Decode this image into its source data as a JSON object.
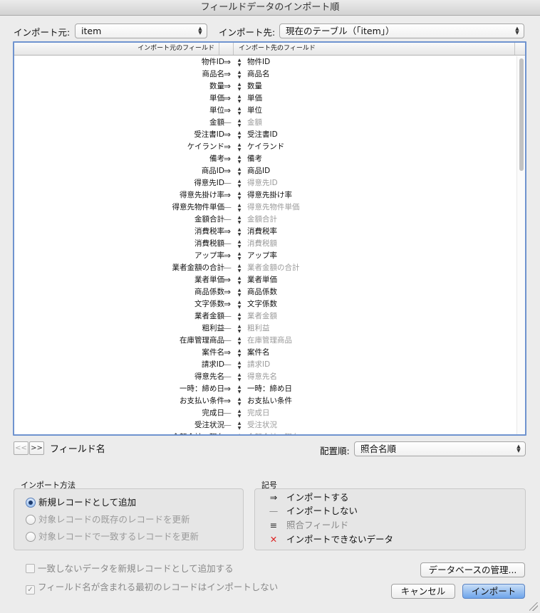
{
  "window": {
    "title": "フィールドデータのインポート順"
  },
  "source": {
    "label": "インポート元:",
    "value": "item"
  },
  "target": {
    "label": "インポート先:",
    "value": "現在のテーブル（「item」）"
  },
  "table": {
    "header_source": "インポート元のフィールド",
    "header_target": "インポート先のフィールド",
    "rows": [
      {
        "src": "物件ID",
        "import": true,
        "dst": "物件ID"
      },
      {
        "src": "商品名",
        "import": true,
        "dst": "商品名"
      },
      {
        "src": "数量",
        "import": true,
        "dst": "数量"
      },
      {
        "src": "単価",
        "import": true,
        "dst": "単価"
      },
      {
        "src": "単位",
        "import": true,
        "dst": "単位"
      },
      {
        "src": "金額",
        "import": false,
        "dst": "金額"
      },
      {
        "src": "受注書ID",
        "import": true,
        "dst": "受注書ID"
      },
      {
        "src": "ケイランド",
        "import": true,
        "dst": "ケイランド"
      },
      {
        "src": "備考",
        "import": true,
        "dst": "備考"
      },
      {
        "src": "商品ID",
        "import": true,
        "dst": "商品ID"
      },
      {
        "src": "得意先ID",
        "import": false,
        "dst": "得意先ID"
      },
      {
        "src": "得意先掛け率",
        "import": true,
        "dst": "得意先掛け率"
      },
      {
        "src": "得意先物件単価",
        "import": false,
        "dst": "得意先物件単価"
      },
      {
        "src": "金額合計",
        "import": false,
        "dst": "金額合計"
      },
      {
        "src": "消費税率",
        "import": true,
        "dst": "消費税率"
      },
      {
        "src": "消費税額",
        "import": false,
        "dst": "消費税額"
      },
      {
        "src": "アップ率",
        "import": true,
        "dst": "アップ率"
      },
      {
        "src": "業者金額の合計",
        "import": false,
        "dst": "業者金額の合計"
      },
      {
        "src": "業者単価",
        "import": true,
        "dst": "業者単価"
      },
      {
        "src": "商品係数",
        "import": true,
        "dst": "商品係数"
      },
      {
        "src": "文字係数",
        "import": true,
        "dst": "文字係数"
      },
      {
        "src": "業者金額",
        "import": false,
        "dst": "業者金額"
      },
      {
        "src": "粗利益",
        "import": false,
        "dst": "粗利益"
      },
      {
        "src": "在庫管理商品",
        "import": false,
        "dst": "在庫管理商品"
      },
      {
        "src": "案件名",
        "import": true,
        "dst": "案件名"
      },
      {
        "src": "請求ID",
        "import": false,
        "dst": "請求ID"
      },
      {
        "src": "得意先名",
        "import": false,
        "dst": "得意先名"
      },
      {
        "src": "一時：締め日",
        "import": true,
        "dst": "一時：締め日"
      },
      {
        "src": "お支払い条件",
        "import": true,
        "dst": "お支払い条件"
      },
      {
        "src": "完成日",
        "import": false,
        "dst": "完成日"
      },
      {
        "src": "受注状況",
        "import": false,
        "dst": "受注状況"
      },
      {
        "src": "金額合計＿現在",
        "import": false,
        "dst": "金額合計＿現在"
      }
    ]
  },
  "nav": {
    "prev": "<<",
    "next": ">>",
    "field_name": "フィールド名"
  },
  "arrange": {
    "label": "配置順:",
    "value": "照合名順"
  },
  "import_method": {
    "title": "インポート方法",
    "options": [
      "新規レコードとして追加",
      "対象レコードの既存のレコードを更新",
      "対象レコードで一致するレコードを更新"
    ],
    "selected": 0
  },
  "legend": {
    "title": "記号",
    "items": [
      {
        "icon": "import-arrow-icon",
        "text": "インポートする"
      },
      {
        "icon": "no-import-dash-icon",
        "text": "インポートしない"
      },
      {
        "icon": "match-field-icon",
        "text": "照合フィールド"
      },
      {
        "icon": "cannot-import-icon",
        "text": "インポートできないデータ"
      }
    ]
  },
  "options": {
    "add_unmatched": "一致しないデータを新規レコードとして追加する",
    "skip_first_record": "フィールド名が含まれる最初のレコードはインポートしない"
  },
  "buttons": {
    "manage_db": "データベースの管理...",
    "cancel": "キャンセル",
    "import": "インポート"
  },
  "symbols": {
    "arrow": "⇒",
    "dash": "—",
    "updown": "▲▼"
  },
  "colors": {
    "selection": "#6f93cf",
    "dim_text": "#9a9a9a",
    "default_button": "#6ea4ea"
  }
}
